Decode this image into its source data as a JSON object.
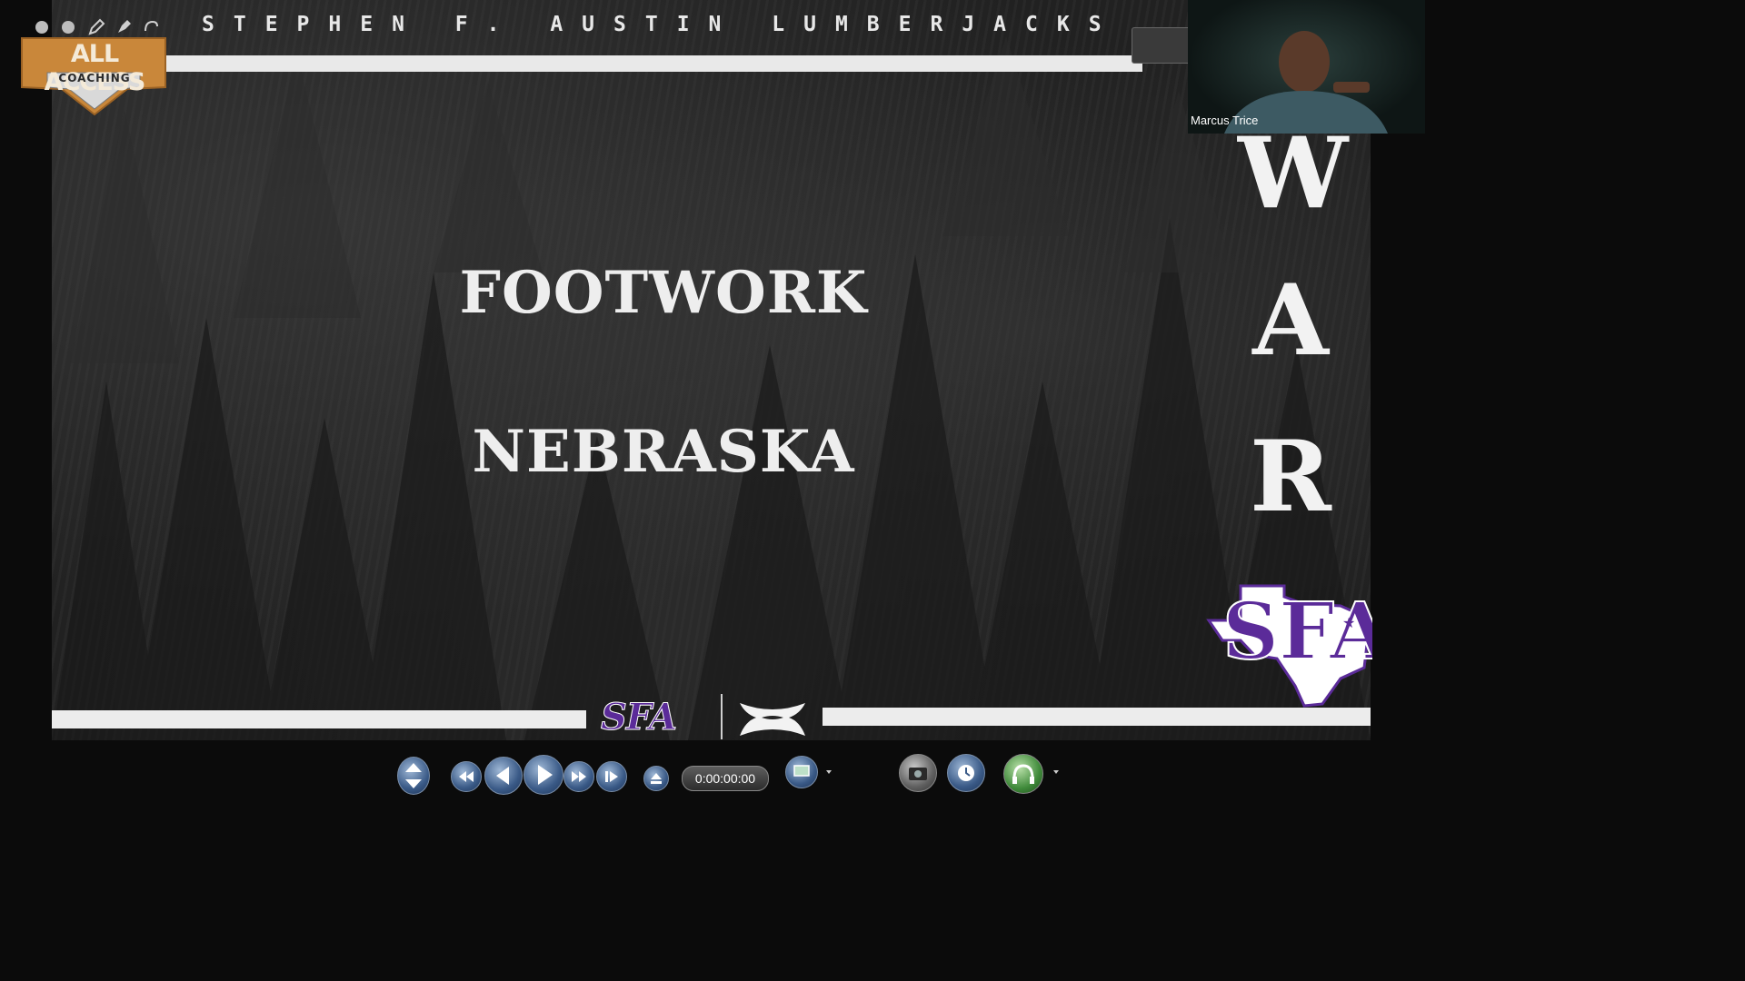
{
  "slide": {
    "header_text": "STEPHEN F. AUSTIN LUMBERJACKS",
    "title_line1": "FOOTWORK",
    "title_line2": "NEBRASKA",
    "side_letters": [
      "W",
      "A",
      "R"
    ],
    "bottom_logo_text": "SFA",
    "corner_logo_text": "SFA"
  },
  "branding": {
    "title": "ALL ACCESS",
    "subtitle": "COACHING"
  },
  "webcam": {
    "participant_name": "Marcus Trice"
  },
  "player": {
    "timecode": "0:00:00:00"
  },
  "colors": {
    "sfa_purple": "#5b2b99",
    "aac_gold": "#c9873a"
  },
  "icons": {
    "top_tools": [
      "dot-icon",
      "dot-icon",
      "pencil-icon",
      "pen-icon",
      "undo-icon"
    ],
    "controls": [
      "playlist-icon",
      "rewind-icon",
      "step-back-icon",
      "play-icon",
      "fast-forward-icon",
      "step-forward-icon",
      "eject-icon",
      "screen-icon",
      "camera-icon",
      "clock-icon",
      "headphones-icon"
    ]
  }
}
